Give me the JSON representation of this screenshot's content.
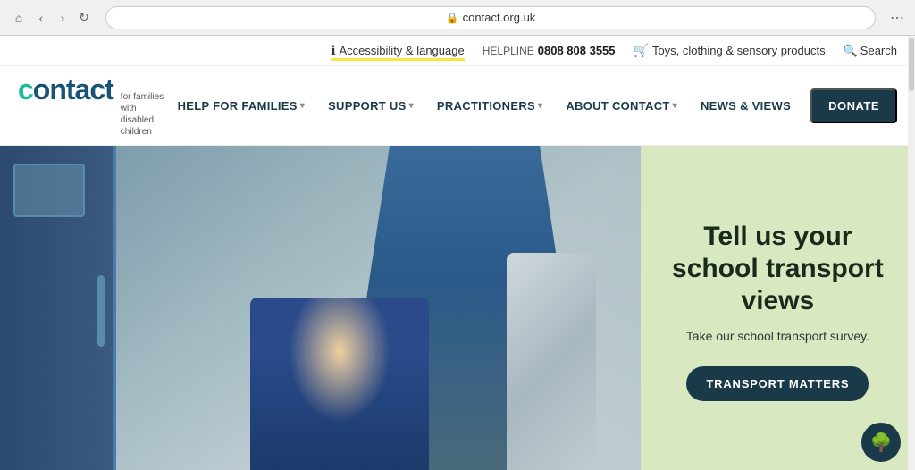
{
  "browser": {
    "url": "contact.org.uk",
    "more_label": "⋯"
  },
  "utility_bar": {
    "accessibility_label": "Accessibility & language",
    "helpline_prefix": "HELPLINE",
    "helpline_number": "0808 808 3555",
    "shop_label": "Toys, clothing & sensory products",
    "search_label": "Search"
  },
  "nav": {
    "logo_text": "contact",
    "logo_tagline_line1": "for families",
    "logo_tagline_line2": "with disabled children",
    "items": [
      {
        "label": "HELP FOR FAMILIES",
        "has_dropdown": true
      },
      {
        "label": "SUPPORT US",
        "has_dropdown": true
      },
      {
        "label": "PRACTITIONERS",
        "has_dropdown": true
      },
      {
        "label": "ABOUT CONTACT",
        "has_dropdown": true
      },
      {
        "label": "NEWS & VIEWS",
        "has_dropdown": false
      }
    ],
    "donate_label": "DONATE"
  },
  "hero": {
    "title": "Tell us your school transport views",
    "subtitle": "Take our school transport survey.",
    "cta_label": "TRANSPORT MATTERS"
  },
  "icons": {
    "info": "ℹ",
    "basket": "🛒",
    "search": "🔍",
    "chevron_down": "▾",
    "tree": "🌳"
  }
}
